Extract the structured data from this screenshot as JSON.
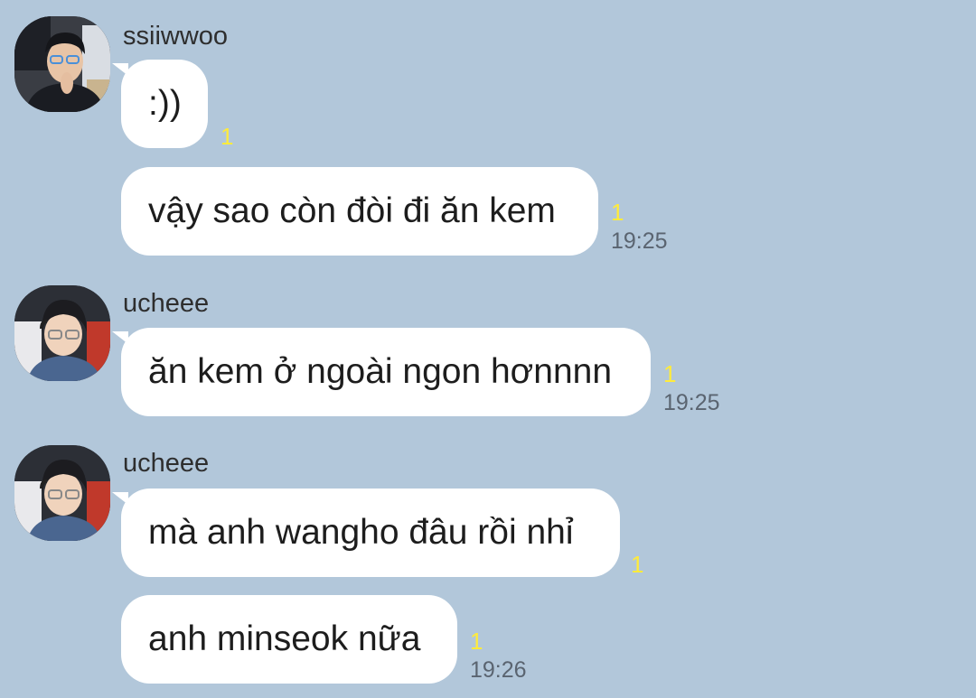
{
  "chat": {
    "groups": [
      {
        "sender": "ssiiwwoo",
        "avatar_icon": "profile-photo-ssiiwwoo",
        "messages": [
          {
            "text": ":))",
            "unread": "1",
            "time": ""
          },
          {
            "text": "vậy sao còn đòi đi ăn kem",
            "unread": "1",
            "time": "19:25"
          }
        ]
      },
      {
        "sender": "ucheee",
        "avatar_icon": "profile-photo-ucheee",
        "messages": [
          {
            "text": "ăn kem ở ngoài ngon hơnnnn",
            "unread": "1",
            "time": "19:25"
          }
        ]
      },
      {
        "sender": "ucheee",
        "avatar_icon": "profile-photo-ucheee",
        "messages": [
          {
            "text": "mà anh wangho đâu rồi nhỉ",
            "unread": "1",
            "time": ""
          },
          {
            "text": "anh minseok nữa",
            "unread": "1",
            "time": "19:26"
          }
        ]
      }
    ]
  },
  "colors": {
    "background": "#b2c7da",
    "bubble": "#ffffff",
    "unread": "#ffeb3b",
    "time": "#5a6470"
  }
}
